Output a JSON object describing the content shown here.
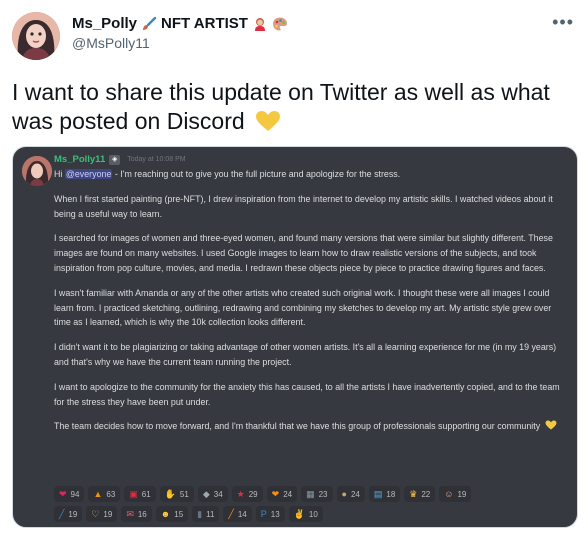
{
  "tweet": {
    "display_name": "Ms_Polly",
    "title_tag": "NFT ARTIST",
    "handle": "@MsPolly11",
    "more_icon": "more-horizontal-icon",
    "text": "I want to share this update on Twitter as well as what was posted on Discord",
    "heart_color": "#f5c842"
  },
  "discord": {
    "username": "Ms_Polly11",
    "timestamp": "Today at 10:08 PM",
    "greeting_prefix": "Hi ",
    "mention": "@everyone",
    "greeting_rest": " - I'm reaching out to give you the full picture and apologize for the stress.",
    "paragraphs": [
      "When I first started painting (pre-NFT), I drew inspiration from the internet to develop my artistic skills. I watched videos about it being a useful way to learn.",
      "I searched for images of women and three-eyed women, and found many versions that were similar but slightly different. These images are found on many websites. I used Google images to learn how to draw realistic versions of the subjects, and took inspiration from pop culture, movies, and media. I redrawn these objects piece by piece to practice drawing figures and faces.",
      "I wasn't familiar with Amanda or any of the other artists who created such original work. I thought these were all images I could learn from. I practiced sketching, outlining, redrawing and combining my sketches to develop my art. My artistic style grew over time as I learned, which is why the 10k collection looks different.",
      "I didn't want it to be plagiarizing or taking advantage of other women artists. It's all a learning experience for me (in my 19 years) and that's why we have the current team running the project.",
      "I want to apologize to the community for the anxiety this has caused, to all the artists I have inadvertently copied, and to the team for the stress they have been put under.",
      "The team decides how to move forward, and I'm thankful that we have this group of professionals supporting our community"
    ],
    "reactions_row1": [
      {
        "icon": "red-heart-icon",
        "glyph": "❤",
        "color": "#e0245e",
        "count": "94"
      },
      {
        "icon": "fire-icon",
        "glyph": "▲",
        "color": "#f4900c",
        "count": "63"
      },
      {
        "icon": "heart-decoration-icon",
        "glyph": "▣",
        "color": "#dd2e44",
        "count": "61"
      },
      {
        "icon": "raising-hands-icon",
        "glyph": "✋",
        "color": "#ffcc4d",
        "count": "51"
      },
      {
        "icon": "praying-hands-icon",
        "glyph": "◆",
        "color": "#9aaab4",
        "count": "34"
      },
      {
        "icon": "dancer-icon",
        "glyph": "★",
        "color": "#dd2e44",
        "count": "29"
      },
      {
        "icon": "orange-heart-icon",
        "glyph": "❤",
        "color": "#f4900c",
        "count": "24"
      },
      {
        "icon": "framed-picture-icon",
        "glyph": "▦",
        "color": "#8899a6",
        "count": "23"
      },
      {
        "icon": "artist-palette-icon",
        "glyph": "●",
        "color": "#c5a572",
        "count": "24"
      },
      {
        "icon": "chart-image-icon",
        "glyph": "▤",
        "color": "#55acee",
        "count": "18"
      },
      {
        "icon": "crown-icon",
        "glyph": "♛",
        "color": "#ffcc4d",
        "count": "22"
      },
      {
        "icon": "woman-face-icon",
        "glyph": "☺",
        "color": "#e6a88e",
        "count": "19"
      }
    ],
    "reactions_row2": [
      {
        "icon": "paintbrush-icon",
        "glyph": "╱",
        "color": "#3b88c3",
        "count": "19"
      },
      {
        "icon": "heart-hands-icon",
        "glyph": "♡",
        "color": "#ffcc4d",
        "count": "19"
      },
      {
        "icon": "love-letter-icon",
        "glyph": "✉",
        "color": "#ea596e",
        "count": "16"
      },
      {
        "icon": "people-icon",
        "glyph": "☻",
        "color": "#ffcc4d",
        "count": "15"
      },
      {
        "icon": "nail-polish-icon",
        "glyph": "▮",
        "color": "#66757f",
        "count": "11"
      },
      {
        "icon": "rainbow-brush-icon",
        "glyph": "╱",
        "color": "#f4900c",
        "count": "14"
      },
      {
        "icon": "p-button-icon",
        "glyph": "P",
        "color": "#3b88c3",
        "count": "13"
      },
      {
        "icon": "thumbs-up-icon",
        "glyph": "✌",
        "color": "#ffcc4d",
        "count": "10"
      }
    ]
  }
}
